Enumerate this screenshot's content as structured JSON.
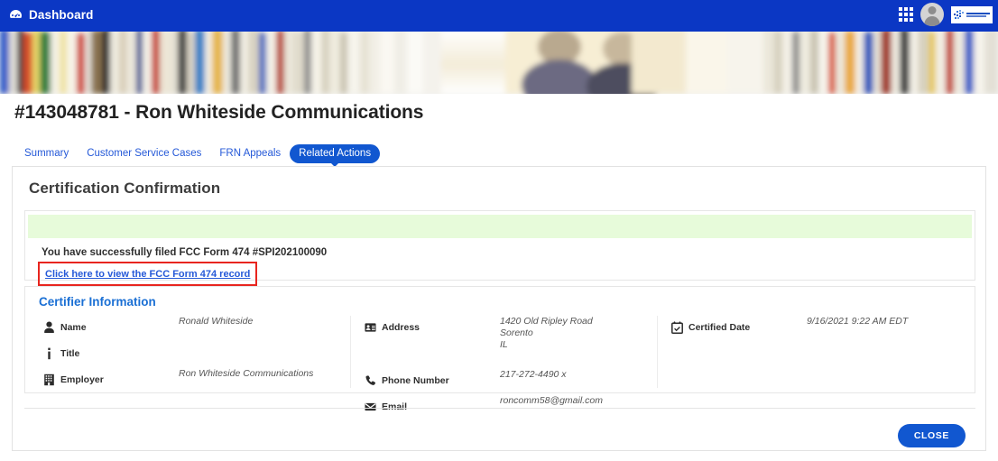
{
  "topbar": {
    "title": "Dashboard",
    "dashboard_icon": "dashboard-icon",
    "apps_icon": "apps-grid-icon",
    "avatar_icon": "user-avatar",
    "logo_name": "usac-logo",
    "logo_alt": "Universal Service Administrative Co.",
    "bg_color": "#0b37c4"
  },
  "banner": {
    "name": "library-bookshelf-banner"
  },
  "page": {
    "title": "#143048781 - Ron Whiteside Communications"
  },
  "tabs": [
    {
      "label": "Summary",
      "active": false
    },
    {
      "label": "Customer Service Cases",
      "active": false
    },
    {
      "label": "FRN Appeals",
      "active": false
    },
    {
      "label": "Related Actions",
      "active": true
    }
  ],
  "card": {
    "heading": "Certification Confirmation"
  },
  "message": {
    "success_banner_color": "#e7fbda",
    "success_text": "You have successfully filed FCC Form 474 #SPI202100090",
    "link_text": "Click here to view the FCC Form 474 record",
    "highlight_color": "#e8251f"
  },
  "certifier": {
    "title": "Certifier Information",
    "title_color": "#1a6fd4",
    "columns": [
      {
        "fields": [
          {
            "icon": "person-icon",
            "label": "Name",
            "value": "Ronald Whiteside"
          },
          {
            "icon": "info-icon",
            "label": "Title",
            "value": ""
          },
          {
            "icon": "building-icon",
            "label": "Employer",
            "value": "Ron Whiteside Communications"
          }
        ]
      },
      {
        "fields": [
          {
            "icon": "address-card-icon",
            "label": "Address",
            "value": "1420 Old Ripley Road\nSorento\nIL"
          },
          {
            "icon": "phone-icon",
            "label": "Phone Number",
            "value": "217-272-4490 x"
          },
          {
            "icon": "envelope-icon",
            "label": "Email",
            "value": "roncomm58@gmail.com"
          }
        ]
      },
      {
        "fields": [
          {
            "icon": "calendar-check-icon",
            "label": "Certified Date",
            "value": "9/16/2021 9:22 AM EDT"
          }
        ]
      }
    ]
  },
  "footer": {
    "close_label": "CLOSE",
    "close_color": "#1157d0"
  }
}
